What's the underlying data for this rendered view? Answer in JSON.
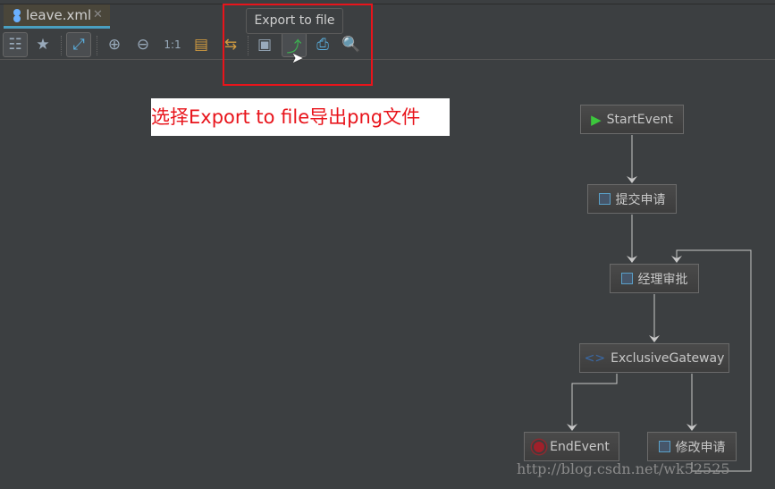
{
  "tab": {
    "label": "leave.xml",
    "close": "✕",
    "icon": "bpmn-file-icon"
  },
  "toolbar": {
    "buttons": [
      "select-icon",
      "star-icon",
      "layout-icon",
      "zoom-in-icon",
      "zoom-out-icon",
      "actual-size-icon",
      "tree-icon",
      "swap-icon",
      "save-icon",
      "export-icon",
      "print-icon",
      "preview-icon"
    ]
  },
  "tooltip": "Export to file",
  "annotation": "选择Export to file导出png文件",
  "diagram": {
    "start": "StartEvent",
    "submit": "提交申请",
    "approve": "经理审批",
    "gateway": "ExclusiveGateway",
    "end": "EndEvent",
    "modify": "修改申请"
  },
  "watermark": "http://blog.csdn.net/wk52525",
  "colors": {
    "accent": "#4a9fc0",
    "highlight": "#e8141b",
    "start": "#3cc83c",
    "end": "#a0202a"
  }
}
